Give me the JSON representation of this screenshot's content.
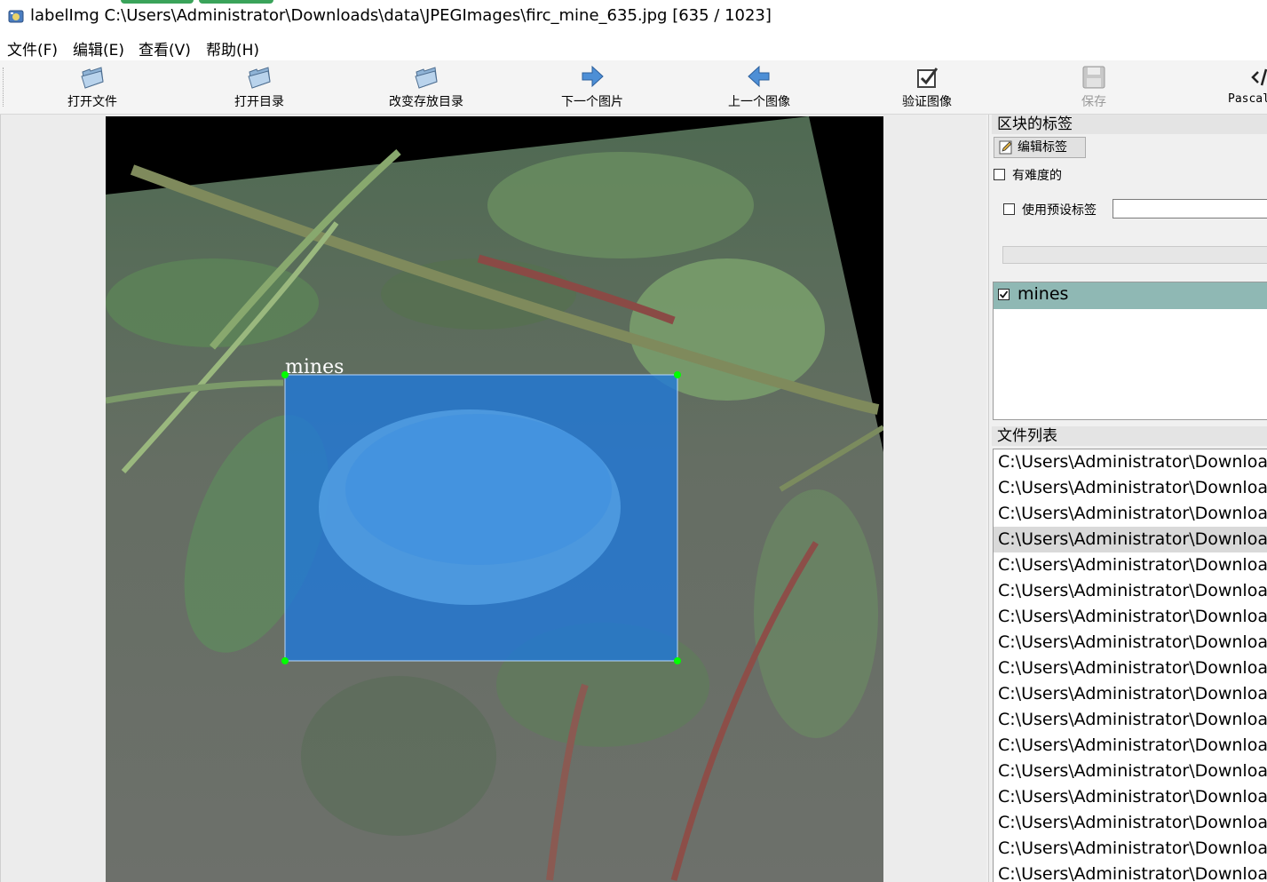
{
  "window": {
    "title": "labelImg C:\\Users\\Administrator\\Downloads\\data\\JPEGImages\\firc_mine_635.jpg [635 / 1023]",
    "accent_color": "#3aa35a"
  },
  "menu": [
    {
      "label": "文件(F)"
    },
    {
      "label": "编辑(E)"
    },
    {
      "label": "查看(V)"
    },
    {
      "label": "帮助(H)"
    }
  ],
  "toolbar": [
    {
      "label": "打开文件",
      "icon": "open-folder-icon",
      "enabled": true
    },
    {
      "label": "打开目录",
      "icon": "open-folder-icon",
      "enabled": true
    },
    {
      "label": "改变存放目录",
      "icon": "open-folder-icon",
      "enabled": true
    },
    {
      "label": "下一个图片",
      "icon": "arrow-right-icon",
      "enabled": true
    },
    {
      "label": "上一个图像",
      "icon": "arrow-left-icon",
      "enabled": true
    },
    {
      "label": "验证图像",
      "icon": "checkbox-check-icon",
      "enabled": true
    },
    {
      "label": "保存",
      "icon": "save-floppy-icon",
      "enabled": false
    },
    {
      "label": "PascalVOC",
      "icon": "code-tag-icon",
      "enabled": true
    }
  ],
  "canvas": {
    "annotation_label": "mines",
    "box_fill_color": "#1e78dc",
    "vertex_color": "#00ff00"
  },
  "box_labels_panel": {
    "title": "区块的标签",
    "edit_button": "编辑标签",
    "difficult_label": "有难度的",
    "difficult_checked": false,
    "use_default_label": "使用预设标签",
    "use_default_checked": false,
    "default_label_value": "",
    "labels": [
      {
        "text": "mines",
        "checked": true
      }
    ],
    "selected_row_color": "#8fb8b4"
  },
  "file_list_panel": {
    "title": "文件列表",
    "selected_index": 3,
    "items": [
      "C:\\Users\\Administrator\\Downloa",
      "C:\\Users\\Administrator\\Downloa",
      "C:\\Users\\Administrator\\Downloa",
      "C:\\Users\\Administrator\\Downloa",
      "C:\\Users\\Administrator\\Downloa",
      "C:\\Users\\Administrator\\Downloa",
      "C:\\Users\\Administrator\\Downloa",
      "C:\\Users\\Administrator\\Downloa",
      "C:\\Users\\Administrator\\Downloa",
      "C:\\Users\\Administrator\\Downloa",
      "C:\\Users\\Administrator\\Downloa",
      "C:\\Users\\Administrator\\Downloa",
      "C:\\Users\\Administrator\\Downloa",
      "C:\\Users\\Administrator\\Downloa",
      "C:\\Users\\Administrator\\Downloa",
      "C:\\Users\\Administrator\\Downloa",
      "C:\\Users\\Administrator\\Downloa"
    ]
  }
}
